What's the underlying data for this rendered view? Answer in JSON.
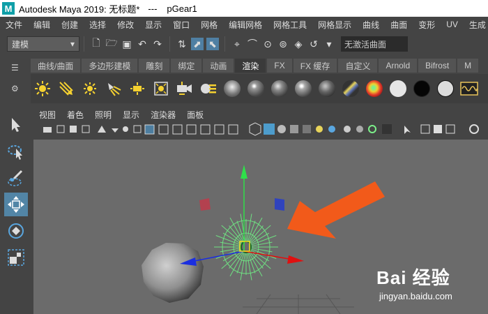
{
  "window": {
    "app_title": "Autodesk Maya 2019: 无标题*",
    "separator": "---",
    "object_name": "pGear1",
    "logo_letter": "M"
  },
  "menubar": [
    "文件",
    "编辑",
    "创建",
    "选择",
    "修改",
    "显示",
    "窗口",
    "网格",
    "编辑网格",
    "网格工具",
    "网格显示",
    "曲线",
    "曲面",
    "变形",
    "UV",
    "生成"
  ],
  "toolline": {
    "mode": "建模",
    "curve_field": "无激活曲面"
  },
  "shelf": {
    "tabs": [
      "曲线/曲面",
      "多边形建模",
      "雕刻",
      "绑定",
      "动画",
      "渲染",
      "FX",
      "FX 缓存",
      "自定义",
      "Arnold",
      "Bifrost",
      "M"
    ],
    "active_tab": "渲染"
  },
  "panel": {
    "menus": [
      "视图",
      "着色",
      "照明",
      "显示",
      "渲染器",
      "面板"
    ]
  },
  "colors": {
    "accent": "#5285a6",
    "arrow": "#f25a1a",
    "gear": "#7cf08a",
    "viewport": "#6b6b6b"
  },
  "watermark": {
    "main": "Bai 经验",
    "sub": "jingyan.baidu.com"
  }
}
